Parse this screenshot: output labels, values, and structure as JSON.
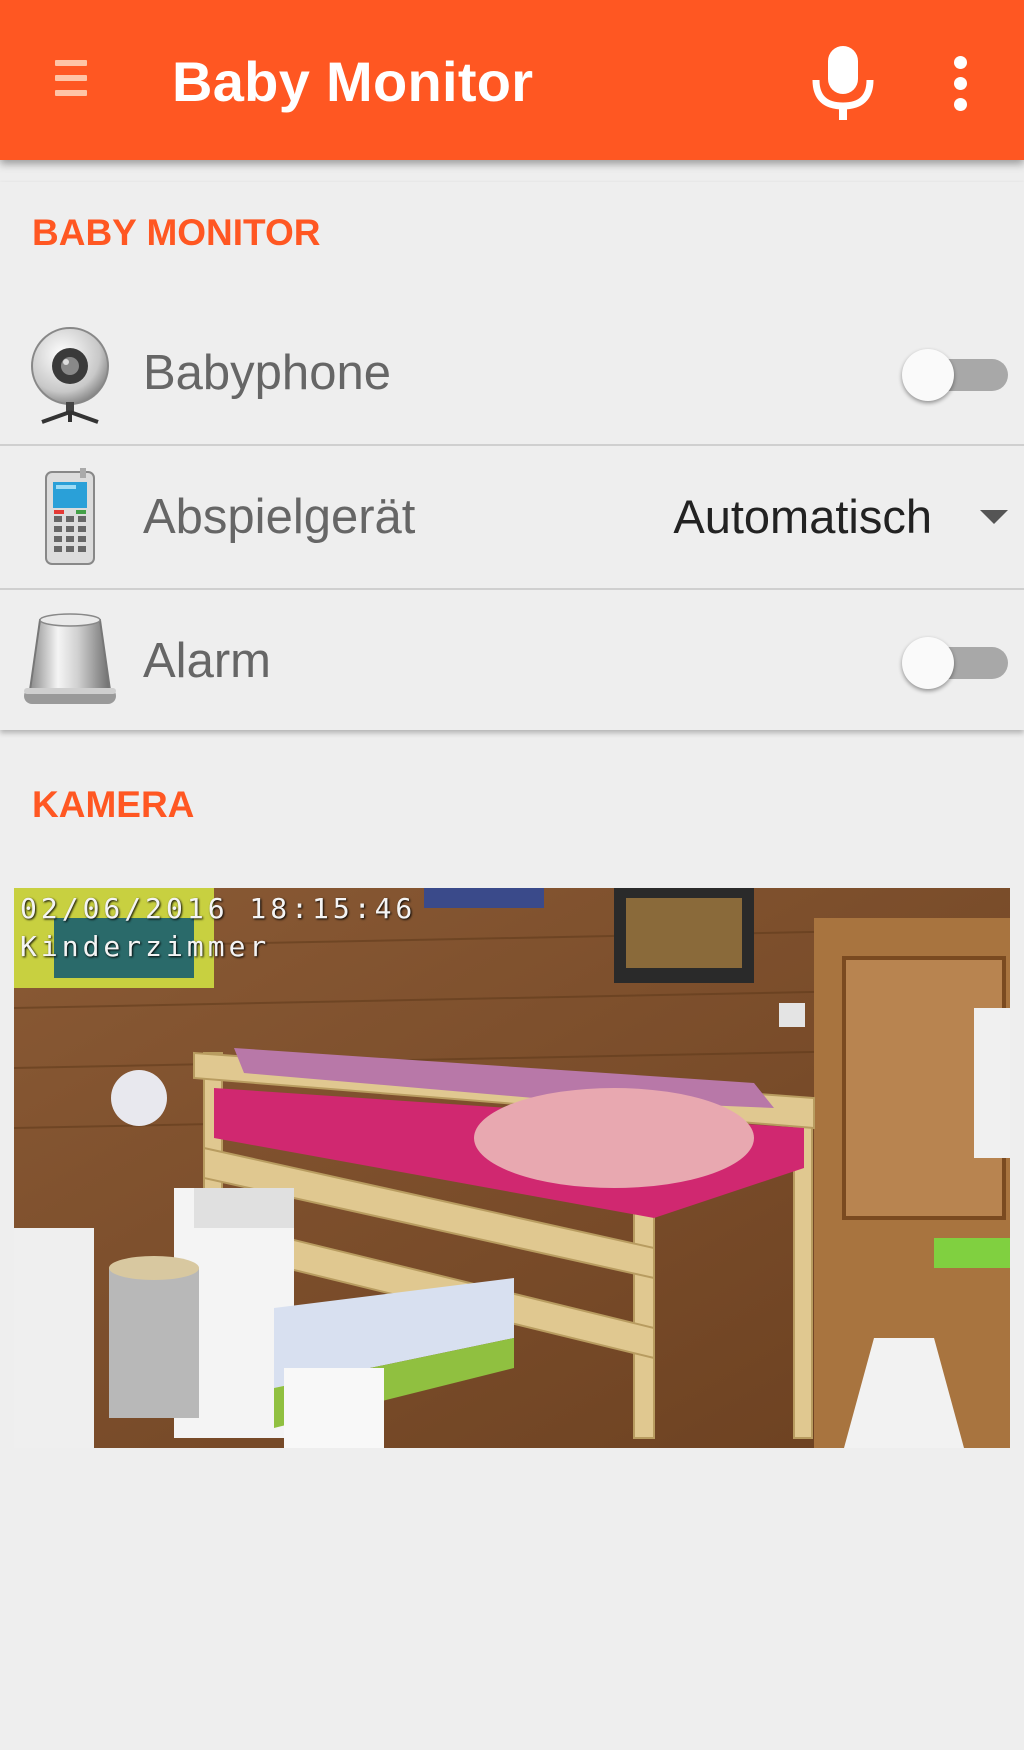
{
  "app_bar": {
    "title": "Baby Monitor",
    "menu_icon": "menu-icon",
    "mic_icon": "microphone-icon",
    "overflow_icon": "more-vert-icon"
  },
  "baby_monitor_section": {
    "header": "BABY MONITOR",
    "rows": [
      {
        "icon": "webcam-icon",
        "label": "Babyphone",
        "control": "switch",
        "checked": false
      },
      {
        "icon": "mobile-phone-icon",
        "label": "Abspielgerät",
        "control": "dropdown",
        "value": "Automatisch"
      },
      {
        "icon": "alarm-light-icon",
        "label": "Alarm",
        "control": "switch",
        "checked": false
      }
    ]
  },
  "camera_section": {
    "header": "KAMERA",
    "feed": {
      "timestamp": "02/06/2016 18:15:46",
      "location": "Kinderzimmer"
    }
  },
  "colors": {
    "accent": "#ff5722",
    "background": "#eeeeee",
    "label": "#666666",
    "switch_off_track": "#a8a8a8"
  }
}
